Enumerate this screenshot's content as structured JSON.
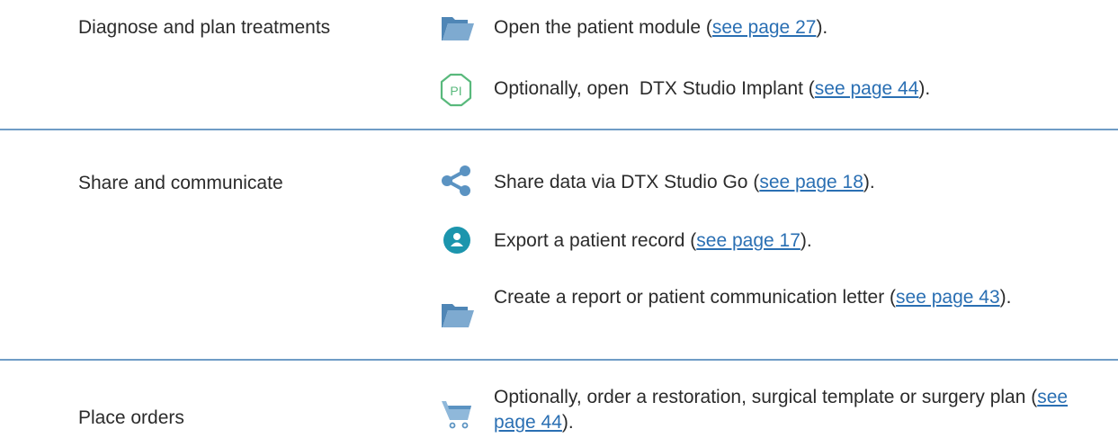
{
  "rows": [
    {
      "category": "Diagnose and plan treatments",
      "items": [
        {
          "icon": "folder-icon",
          "text_before": "Open the patient module (",
          "link": "see page 27",
          "text_after": ")."
        },
        {
          "icon": "pi-hexagon-icon",
          "icon_text": "PI",
          "text_before": "Optionally, open  DTX Studio Implant (",
          "link": "see page 44",
          "text_after": ")."
        }
      ]
    },
    {
      "category": "Share and communicate",
      "items": [
        {
          "icon": "share-icon",
          "text_before": "Share data via DTX Studio Go (",
          "link": "see page 18",
          "text_after": ")."
        },
        {
          "icon": "patient-record-icon",
          "text_before": "Export a patient record (",
          "link": "see page 17",
          "text_after": ")."
        },
        {
          "icon": "folder-icon",
          "text_before": "Create a report or patient communication letter (",
          "link": "see page 43",
          "text_after": ")."
        }
      ]
    },
    {
      "category": "Place orders",
      "items": [
        {
          "icon": "cart-icon",
          "text_before": "Optionally, order a restoration, surgical template or surgery plan (",
          "link": "see page 44",
          "text_after": ")."
        }
      ]
    }
  ],
  "colors": {
    "icon_blue": "#5b93c2",
    "divider": "#6f9cc6",
    "link": "#2a6fb3",
    "icon_teal": "#1c95ad",
    "pi_green": "#59b97c"
  }
}
